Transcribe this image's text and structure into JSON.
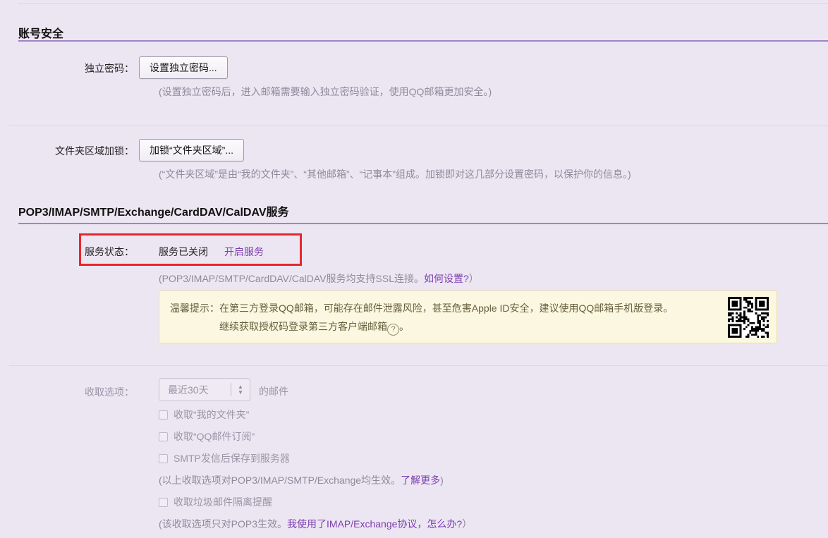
{
  "colors": {
    "page_bg": "#ece6f3",
    "section_rule": "#a183c0",
    "link": "#7d3daf",
    "highlight_red": "#e8262c",
    "notice_bg": "#fcf7e0",
    "notice_border": "#e8dfae",
    "notice_text": "#665f3e"
  },
  "account": {
    "title": "账号安全",
    "password": {
      "label": "独立密码：",
      "button": "设置独立密码...",
      "hint": "(设置独立密码后，进入邮箱需要输入独立密码验证，使用QQ邮箱更加安全。)"
    },
    "folder_lock": {
      "label": "文件夹区域加锁：",
      "button": "加锁“文件夹区域”...",
      "hint": "(“文件夹区域”是由“我的文件夹”、“其他邮箱”、“记事本”组成。加锁即对这几部分设置密码，以保护你的信息。)"
    }
  },
  "services": {
    "title": "POP3/IMAP/SMTP/Exchange/CardDAV/CalDAV服务",
    "status": {
      "label": "服务状态：",
      "value": "服务已关闭",
      "action": "开启服务"
    },
    "ssl_hint": {
      "prefix": "(POP3/IMAP/SMTP/CardDAV/CalDAV服务均支持SSL连接。",
      "link": "如何设置?",
      "suffix": "）"
    },
    "notice": {
      "label": "温馨提示：",
      "line1": "在第三方登录QQ邮箱，可能存在邮件泄露风险，甚至危害Apple ID安全，建议使用QQ邮箱手机版登录。",
      "line2": "继续获取授权码登录第三方客户端邮箱",
      "line2_tail": "。",
      "help": "?"
    }
  },
  "fetch": {
    "label": "收取选项：",
    "range_value": "最近30天",
    "range_suffix": "的邮件",
    "options": [
      "收取“我的文件夹”",
      "收取“QQ邮件订阅”",
      "SMTP发信后保存到服务器"
    ],
    "options_hint": {
      "prefix": "(以上收取选项对POP3/IMAP/SMTP/Exchange均生效。",
      "link": "了解更多",
      "suffix": ")"
    },
    "spam_option": "收取垃圾邮件隔离提醒",
    "spam_hint": {
      "prefix": "(该收取选项只对POP3生效。",
      "link": "我使用了IMAP/Exchange协议，怎么办?",
      "suffix": "）"
    }
  }
}
